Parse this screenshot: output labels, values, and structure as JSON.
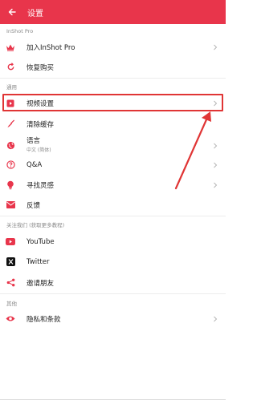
{
  "appbar": {
    "title": "设置",
    "back_icon": "arrow-left-icon"
  },
  "sections": {
    "pro": "InShot Pro",
    "general": "通用",
    "follow": "关注我们 (获取更多教程)",
    "other": "其他"
  },
  "items": {
    "pro_join": "加入InShot Pro",
    "restore": "恢复购买",
    "video_settings": "视频设置",
    "clear_cache": "清除缓存",
    "language": "语言",
    "language_value": "中文 (简体)",
    "qa": "Q&A",
    "inspiration": "寻找灵感",
    "feedback": "反馈",
    "youtube": "YouTube",
    "twitter": "Twitter",
    "invite": "邀请朋友",
    "privacy": "隐私和条款"
  },
  "colors": {
    "accent": "#e8354b",
    "highlight": "#e03535"
  }
}
